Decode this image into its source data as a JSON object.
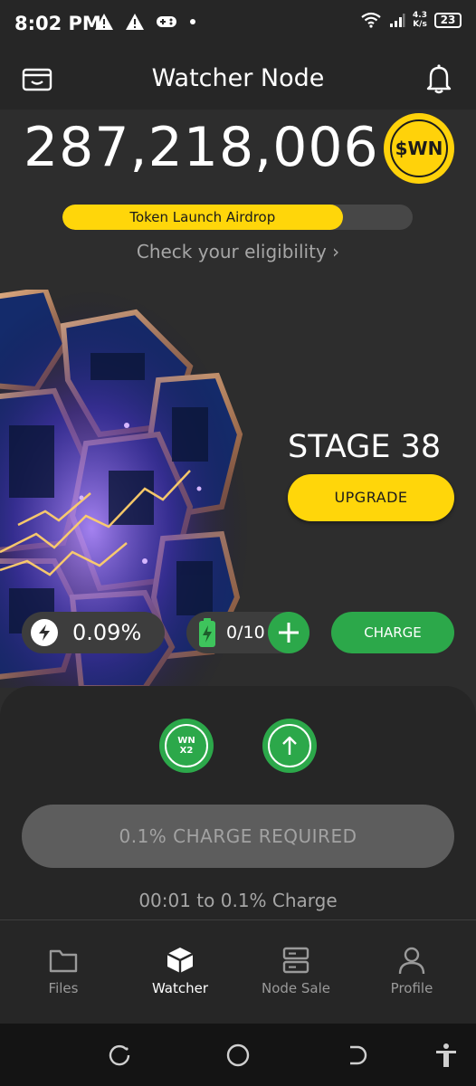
{
  "status_bar": {
    "time": "8:02 PM",
    "net_speed_value": "4.3",
    "net_speed_unit": "K/s",
    "battery_level": "23",
    "icons": [
      "warning-icon",
      "warning-icon",
      "gamepad-icon",
      "dot-icon",
      "wifi-icon",
      "signal-icon",
      "battery-icon"
    ]
  },
  "header": {
    "title": "Watcher Node",
    "left_icon": "wallet-icon",
    "right_icon": "bell-icon"
  },
  "balance": {
    "amount": "287,218,006",
    "token_symbol": "$WN"
  },
  "airdrop": {
    "label": "Token Launch Airdrop",
    "progress": 0.8,
    "eligibility_link": "Check your eligibility ›"
  },
  "stage": {
    "label": "STAGE 38",
    "upgrade_label": "UPGRADE"
  },
  "stats": {
    "rate": "0.09%",
    "charges": "0/10",
    "charge_label": "CHARGE"
  },
  "boosts": {
    "multiplier_line1": "WN",
    "multiplier_line2": "X2"
  },
  "action": {
    "button_label": "0.1% CHARGE REQUIRED",
    "countdown": "00:01 to 0.1% Charge"
  },
  "nav": {
    "items": [
      {
        "label": "Files",
        "icon": "folder-icon",
        "active": false
      },
      {
        "label": "Watcher",
        "icon": "cube-icon",
        "active": true
      },
      {
        "label": "Node Sale",
        "icon": "server-icon",
        "active": false
      },
      {
        "label": "Profile",
        "icon": "person-icon",
        "active": false
      }
    ]
  },
  "colors": {
    "accent_yellow": "#ffd60a",
    "accent_green": "#2ca84a",
    "background": "#2d2d2d",
    "panel": "#262626"
  }
}
